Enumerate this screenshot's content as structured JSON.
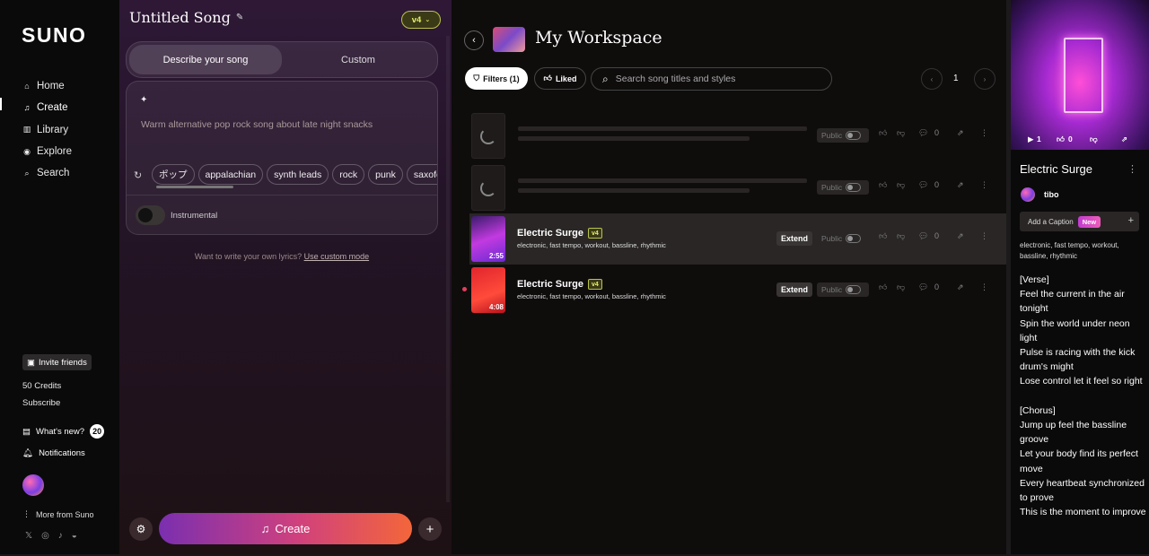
{
  "brand": "SUNO",
  "nav": {
    "items": [
      {
        "label": "Home",
        "icon": "home-icon"
      },
      {
        "label": "Create",
        "icon": "music-note-icon"
      },
      {
        "label": "Library",
        "icon": "library-icon"
      },
      {
        "label": "Explore",
        "icon": "compass-icon"
      },
      {
        "label": "Search",
        "icon": "search-icon"
      }
    ],
    "invite_label": "Invite friends",
    "credits": "50 Credits",
    "subscribe": "Subscribe",
    "whats_new": "What's new?",
    "whats_new_count": "20",
    "notifications": "Notifications",
    "more_from": "More from Suno"
  },
  "create": {
    "song_title": "Untitled Song",
    "version": "v4",
    "tabs": [
      "Describe your song",
      "Custom"
    ],
    "prompt": "Warm alternative pop rock song about late night snacks",
    "chips": [
      "ポップ",
      "appalachian",
      "synth leads",
      "rock",
      "punk",
      "saxofon"
    ],
    "instrumental_label": "Instrumental",
    "lyrics_hint": "Want to write your own lyrics?",
    "lyrics_link": "Use custom mode",
    "create_label": "Create"
  },
  "workspace": {
    "title": "My Workspace",
    "filters_label": "Filters (1)",
    "liked_label": "Liked",
    "search_placeholder": "Search song titles and styles",
    "page": "1",
    "public_label": "Public",
    "extend_label": "Extend",
    "rows": [
      {
        "state": "loading",
        "comments": "0"
      },
      {
        "state": "loading",
        "comments": "0"
      },
      {
        "state": "ready",
        "title": "Electric Surge",
        "version": "v4",
        "tags": "electronic, fast tempo, workout, bassline, rhythmic",
        "duration": "2:55",
        "comments": "0"
      },
      {
        "state": "ready",
        "title": "Electric Surge",
        "version": "v4",
        "tags": "electronic, fast tempo, workout, bassline, rhythmic",
        "duration": "4:08",
        "comments": "0"
      }
    ]
  },
  "details": {
    "plays": "1",
    "likes": "0",
    "title": "Electric Surge",
    "user": "tibo",
    "caption_label": "Add a Caption",
    "new_badge": "New",
    "tags": "electronic, fast tempo, workout, bassline, rhythmic",
    "lyrics": "[Verse]\nFeel the current in the air tonight\nSpin the world under neon light\nPulse is racing with the kick drum's might\nLose control let it feel so right\n\n[Chorus]\nJump up feel the bassline groove\nLet your body find its perfect move\nEvery heartbeat synchronized to prove\nThis is the moment to improve"
  }
}
